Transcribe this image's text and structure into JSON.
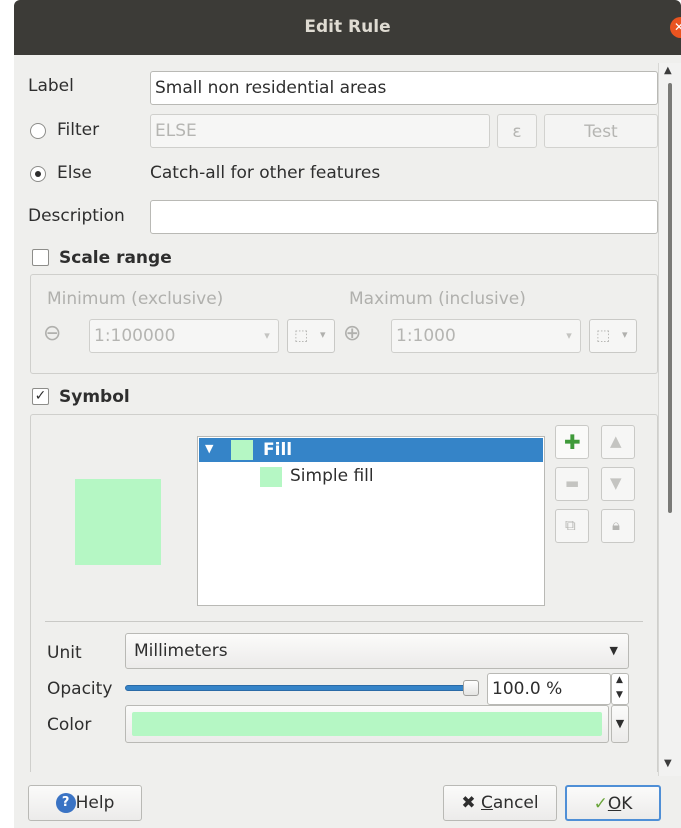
{
  "window": {
    "title": "Edit Rule"
  },
  "form": {
    "label_caption": "Label",
    "label_value": "Small non residential areas",
    "filter_caption": "Filter",
    "filter_value": "ELSE",
    "expression_glyph": "ε",
    "test_label": "Test",
    "else_caption": "Else",
    "else_description": "Catch-all for other features",
    "description_caption": "Description",
    "description_value": ""
  },
  "scale_range": {
    "caption": "Scale range",
    "checked": false,
    "minimum_label": "Minimum (exclusive)",
    "maximum_label": "Maximum (inclusive)",
    "minimum_value": "1:100000",
    "maximum_value": "1:1000"
  },
  "symbol": {
    "caption": "Symbol",
    "checked": true,
    "tree": [
      {
        "label": "Fill",
        "selected": true
      },
      {
        "label": "Simple fill",
        "selected": false
      }
    ],
    "unit_label": "Unit",
    "unit_value": "Millimeters",
    "opacity_label": "Opacity",
    "opacity_value": "100.0 %",
    "opacity_fraction": 1.0,
    "color_label": "Color",
    "fill_color": "#b5f7c4"
  },
  "buttons": {
    "help": "Help",
    "cancel_prefix": "C",
    "cancel_rest": "ancel",
    "ok_prefix": "O",
    "ok_rest": "K"
  },
  "colors": {
    "titlebar": "#3c3b37",
    "selection": "#3584c8",
    "close": "#e95420"
  }
}
